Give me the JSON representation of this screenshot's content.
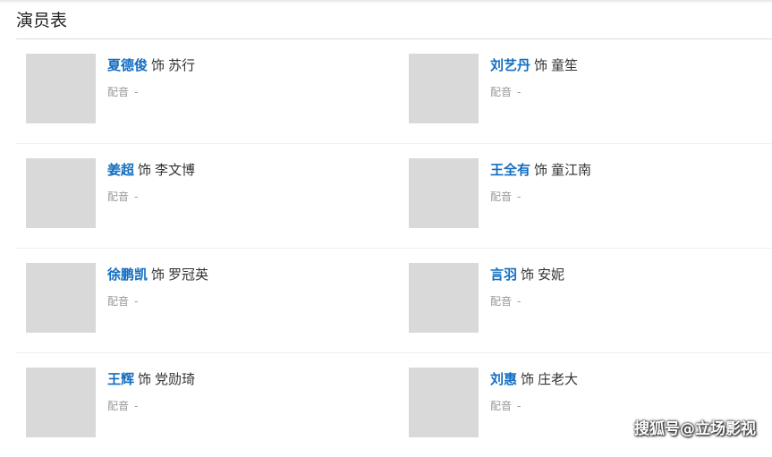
{
  "section": {
    "title": "演员表"
  },
  "cast": [
    {
      "actor": "夏德俊",
      "as": "饰",
      "role": "苏行",
      "voice_label": "配音",
      "voice_value": "-",
      "photo": {
        "icon": "actor-photo",
        "bg": "#3a3a3a",
        "shirt": "#2b2b2b"
      }
    },
    {
      "actor": "刘艺丹",
      "as": "饰",
      "role": "童笙",
      "voice_label": "配音",
      "voice_value": "-",
      "photo": {
        "icon": "actor-photo",
        "bg": "#d7ecec",
        "shirt": "#e8e4de"
      }
    },
    {
      "actor": "姜超",
      "as": "饰",
      "role": "李文博",
      "voice_label": "配音",
      "voice_value": "-",
      "photo": {
        "icon": "actor-photo",
        "bg": "#7a7a7a",
        "shirt": "#1e1e1e"
      }
    },
    {
      "actor": "王全有",
      "as": "饰",
      "role": "童江南",
      "voice_label": "配音",
      "voice_value": "-",
      "photo": {
        "icon": "actor-photo",
        "bg": "#151515",
        "shirt": "#262626"
      }
    },
    {
      "actor": "徐鹏凯",
      "as": "饰",
      "role": "罗冠英",
      "voice_label": "配音",
      "voice_value": "-",
      "photo": {
        "icon": "actor-photo",
        "bg": "#c9cccf",
        "shirt": "#3a3f46"
      }
    },
    {
      "actor": "言羽",
      "as": "饰",
      "role": "安妮",
      "voice_label": "配音",
      "voice_value": "-",
      "photo": {
        "icon": "actor-photo",
        "bg": "#e3e6ea",
        "shirt": "#8aa0c0"
      }
    },
    {
      "actor": "王辉",
      "as": "饰",
      "role": "党勋琦",
      "voice_label": "配音",
      "voice_value": "-",
      "photo": {
        "icon": "actor-photo",
        "bg": "#d8dde2",
        "shirt": "#1e2a3a"
      }
    },
    {
      "actor": "刘惠",
      "as": "饰",
      "role": "庄老大",
      "voice_label": "配音",
      "voice_value": "-",
      "photo": {
        "icon": "actor-photo",
        "bg": "#c0552e",
        "shirt": "#e7b32a"
      }
    }
  ],
  "watermark": "搜狐号@立场影视"
}
